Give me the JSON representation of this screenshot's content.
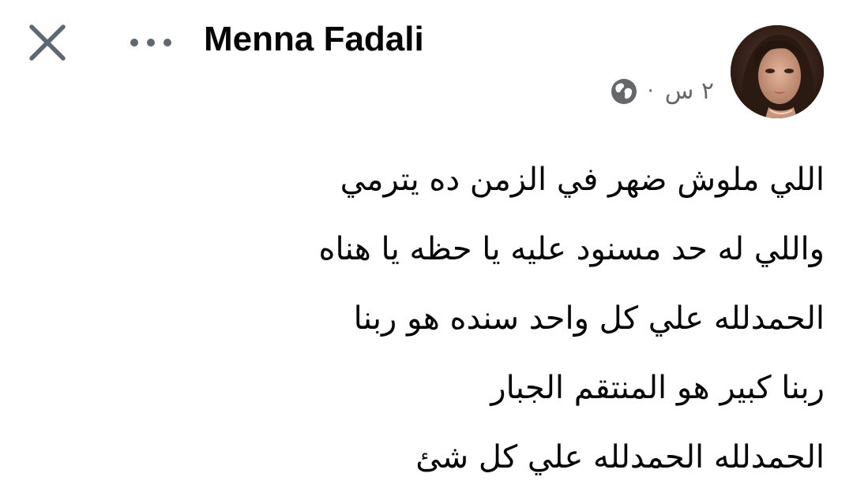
{
  "header": {
    "close_icon": "close-icon",
    "more_icon": "more-horizontal-icon",
    "author_name": "Menna Fadali"
  },
  "meta": {
    "timestamp": "٢ س",
    "separator": "·",
    "privacy_icon": "globe-icon"
  },
  "post": {
    "lines": [
      "اللي ملوش ضهر في الزمن ده يترمي",
      "واللي له حد مسنود عليه يا حظه يا هناه",
      "الحمدلله علي كل واحد سنده هو ربنا",
      "ربنا كبير هو المنتقم الجبار",
      "الحمدلله الحمدلله علي كل شئ"
    ]
  },
  "colors": {
    "text_primary": "#050505",
    "text_secondary": "#65676b",
    "icon_gray": "#606770",
    "background": "#ffffff"
  }
}
